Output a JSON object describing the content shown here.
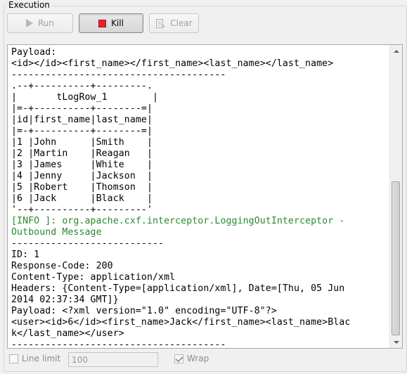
{
  "panel": {
    "title": "Execution"
  },
  "toolbar": {
    "run_label": "Run",
    "kill_label": "Kill",
    "clear_label": "Clear"
  },
  "console": {
    "lines": [
      "Payload:",
      "<id></id><first_name></first_name><last_name></last_name>",
      "--------------------------------------",
      ".--+----------+---------.",
      "|       tLogRow_1        |",
      "|=-+----------+--------=|",
      "|id|first_name|last_name|",
      "|=-+----------+--------=|",
      "|1 |John      |Smith    |",
      "|2 |Martin    |Reagan   |",
      "|3 |James     |White    |",
      "|4 |Jenny     |Jackson  |",
      "|5 |Robert    |Thomson  |",
      "|6 |Jack      |Black    |",
      "'--+----------+---------'",
      "[INFO ]: org.apache.cxf.interceptor.LoggingOutInterceptor -",
      "Outbound Message",
      "---------------------------",
      "ID: 1",
      "Response-Code: 200",
      "Content-Type: application/xml",
      "Headers: {Content-Type=[application/xml], Date=[Thu, 05 Jun",
      "2014 02:37:34 GMT]}",
      "Payload: <?xml version=\"1.0\" encoding=\"UTF-8\"?>",
      "<user><id>6</id><first_name>Jack</first_name><last_name>Blac",
      "k</last_name></user>",
      "--------------------------------------"
    ],
    "info_line_indices": [
      15,
      16
    ],
    "info_color": "#2b8a2b"
  },
  "footer": {
    "line_limit_label": "Line limit",
    "line_limit_checked": false,
    "line_limit_value": "100",
    "wrap_label": "Wrap",
    "wrap_checked": true
  },
  "icons": {
    "run": "play-icon",
    "kill": "stop-icon",
    "clear": "clear-icon"
  },
  "colors": {
    "kill_red": "#e8222a",
    "info_green": "#2b8a2b"
  }
}
